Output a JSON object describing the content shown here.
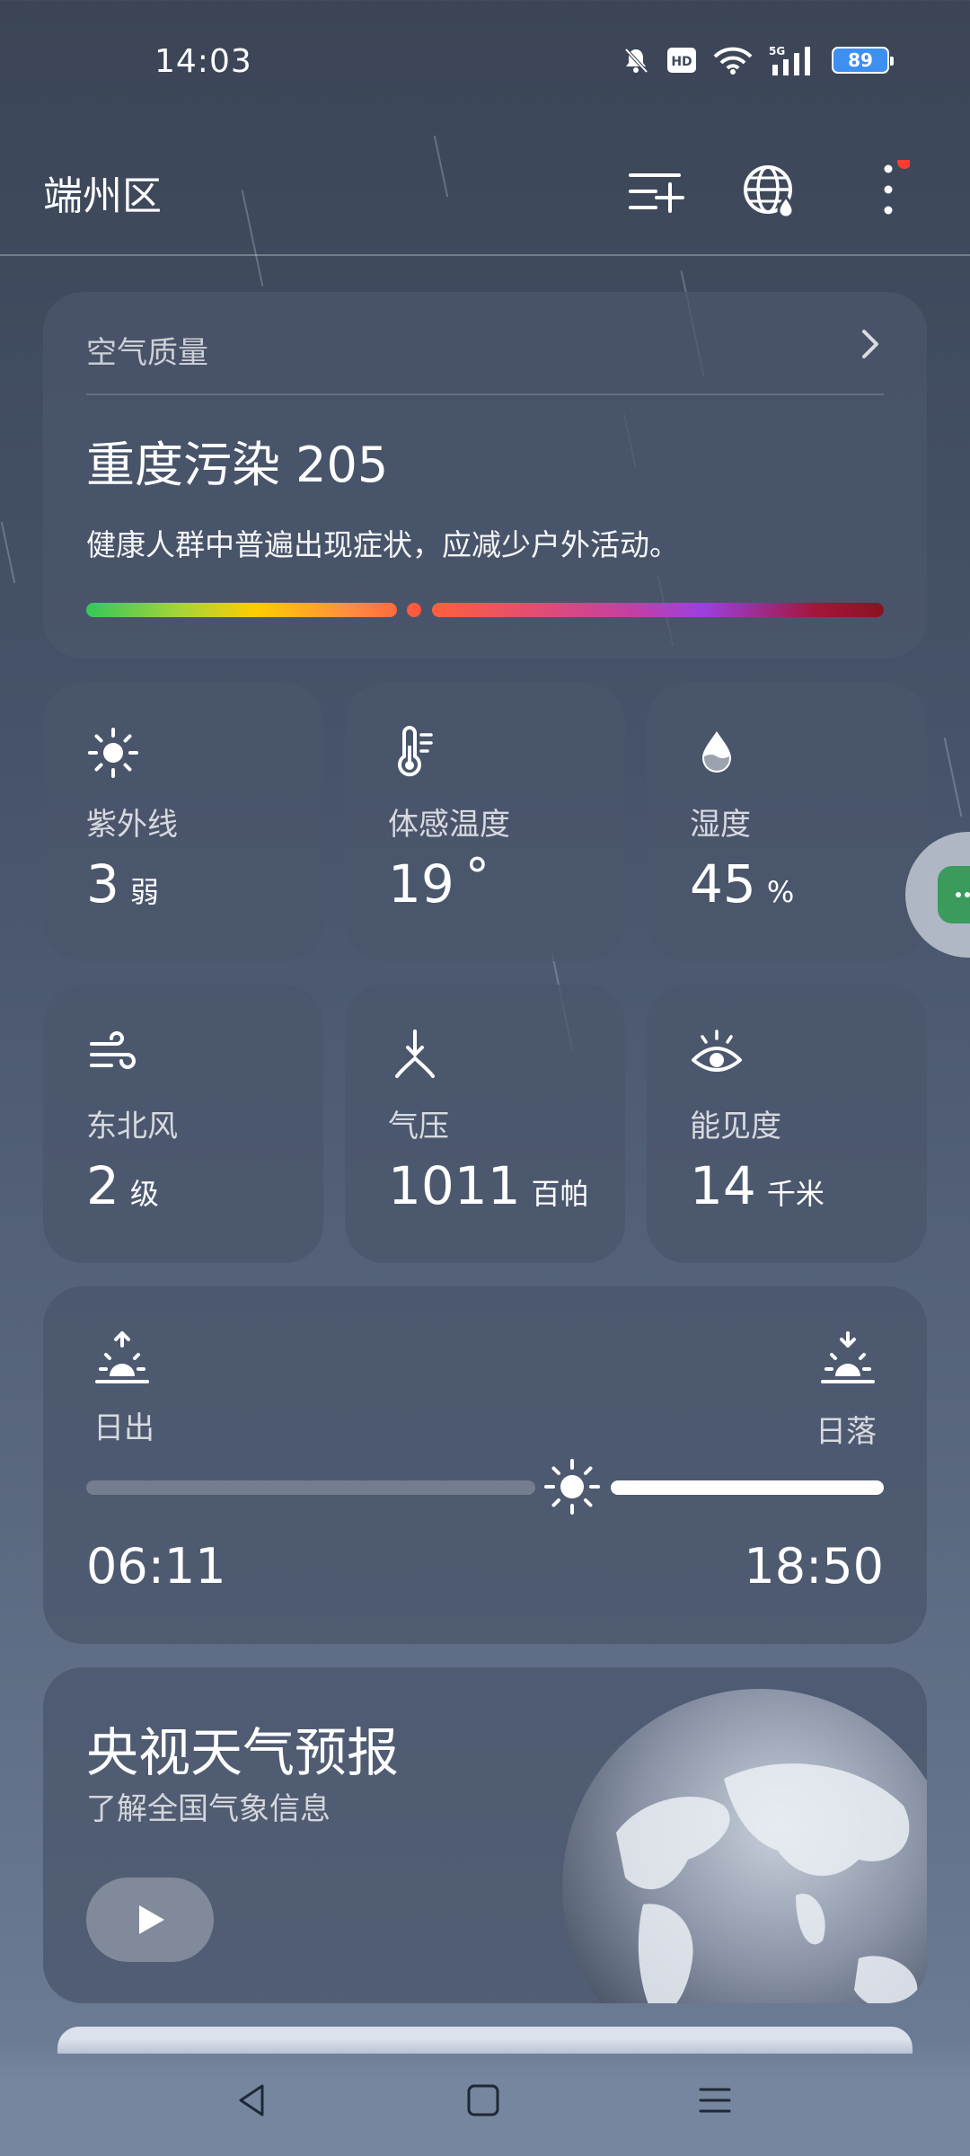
{
  "status_bar": {
    "time": "14:03",
    "network": "5G",
    "battery": "89",
    "icons": [
      "mute-bell-icon",
      "hd-icon",
      "wifi-icon",
      "signal-icon",
      "battery-icon"
    ]
  },
  "header": {
    "city": "端州区",
    "icons": [
      "add-city-icon",
      "globe-rain-icon",
      "more-icon"
    ],
    "notification_color": "#ff3b30"
  },
  "aqi": {
    "title": "空气质量",
    "value": "重度污染 205",
    "description": "健康人群中普遍出现症状，应减少户外活动。",
    "index": 205
  },
  "tiles": [
    {
      "icon": "sun-icon",
      "label": "紫外线",
      "value": "3",
      "unit": "弱"
    },
    {
      "icon": "thermometer-icon",
      "label": "体感温度",
      "value": "19",
      "unit": "°"
    },
    {
      "icon": "water-drop-icon",
      "label": "湿度",
      "value": "45",
      "unit": "%"
    },
    {
      "icon": "wind-icon",
      "label": "东北风",
      "value": "2",
      "unit": "级"
    },
    {
      "icon": "pressure-icon",
      "label": "气压",
      "value": "1011",
      "unit": "百帕"
    },
    {
      "icon": "eye-icon",
      "label": "能见度",
      "value": "14",
      "unit": "千米"
    }
  ],
  "sun": {
    "sunrise_label": "日出",
    "sunset_label": "日落",
    "sunrise_time": "06:11",
    "sunset_time": "18:50",
    "progress": 0.58
  },
  "cctv": {
    "title": "央视天气预报",
    "subtitle": "了解全国气象信息"
  },
  "nav": {
    "icons": [
      "back-icon",
      "home-icon",
      "recents-icon"
    ]
  }
}
